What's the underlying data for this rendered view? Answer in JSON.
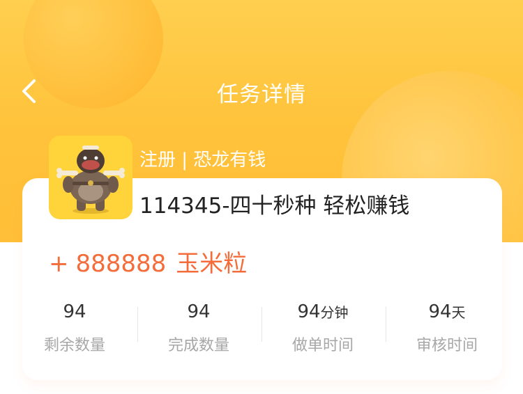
{
  "header": {
    "title": "任务详情"
  },
  "task": {
    "category": "注册 | 恐龙有钱",
    "name": "114345-四十秒种 轻松赚钱",
    "reward": {
      "plus": "+",
      "amount": "888888",
      "unit": "玉米粒"
    }
  },
  "stats": [
    {
      "value": "94",
      "suffix": "",
      "label": "剩余数量"
    },
    {
      "value": "94",
      "suffix": "",
      "label": "完成数量"
    },
    {
      "value": "94",
      "suffix": "分钟",
      "label": "做单时间"
    },
    {
      "value": "94",
      "suffix": "天",
      "label": "审核时间"
    }
  ],
  "colors": {
    "accent": "#ffc23a",
    "reward": "#f46c3a",
    "avatar_bg": "#ffd33a"
  },
  "icons": {
    "back": "chevron-left-icon"
  }
}
